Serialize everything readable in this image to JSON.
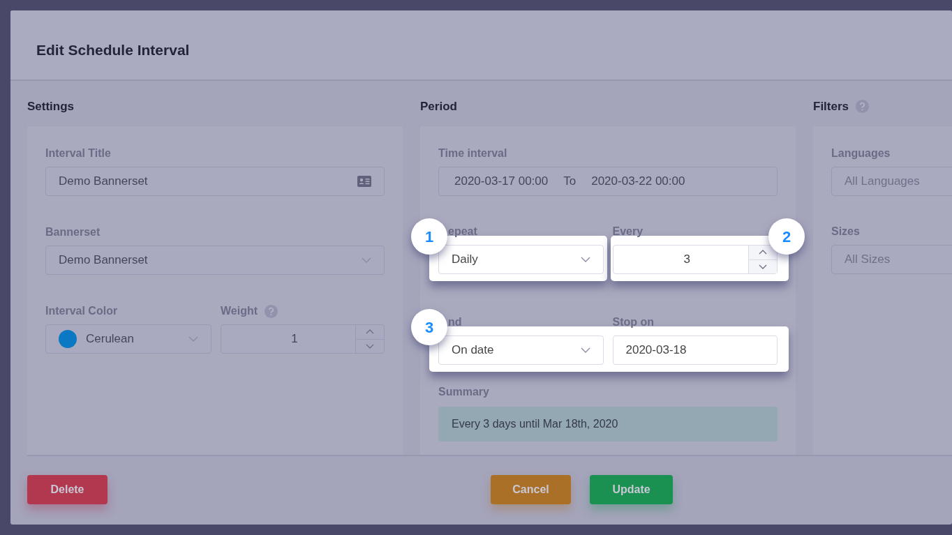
{
  "dialog": {
    "title": "Edit Schedule Interval"
  },
  "settings": {
    "heading": "Settings",
    "title_field": {
      "label": "Interval Title",
      "value": "Demo Bannerset"
    },
    "bannerset_field": {
      "label": "Bannerset",
      "value": "Demo Bannerset"
    },
    "color_field": {
      "label": "Interval Color",
      "value": "Cerulean",
      "color": "#0a78c2"
    },
    "weight_field": {
      "label": "Weight",
      "value": "1"
    }
  },
  "period": {
    "heading": "Period",
    "time_interval": {
      "label": "Time interval",
      "from": "2020-03-17 00:00",
      "separator": "To",
      "to": "2020-03-22 00:00"
    },
    "rows": [
      {
        "kind": "split",
        "steps": [
          "1",
          "2"
        ],
        "fields": [
          {
            "kind": "select",
            "label": "epeat",
            "value": "Daily"
          },
          {
            "kind": "number",
            "label": "Every",
            "value": "3"
          }
        ]
      },
      {
        "kind": "joined",
        "steps": [
          "3"
        ],
        "fields": [
          {
            "kind": "select",
            "label": "nd",
            "value": "On date"
          },
          {
            "kind": "text",
            "label": "Stop on",
            "value": "2020-03-18"
          }
        ]
      }
    ],
    "summary": {
      "label": "Summary",
      "text": "Every 3 days until Mar 18th, 2020"
    }
  },
  "filters": {
    "heading": "Filters",
    "fields": [
      {
        "label": "Languages",
        "placeholder": "All Languages"
      },
      {
        "label": "Sizes",
        "placeholder": "All Sizes"
      }
    ]
  },
  "footer": {
    "buttons": [
      {
        "kind": "danger",
        "label": "Delete"
      },
      {
        "kind": "warning",
        "label": "Cancel"
      },
      {
        "kind": "success",
        "label": "Update"
      }
    ]
  }
}
